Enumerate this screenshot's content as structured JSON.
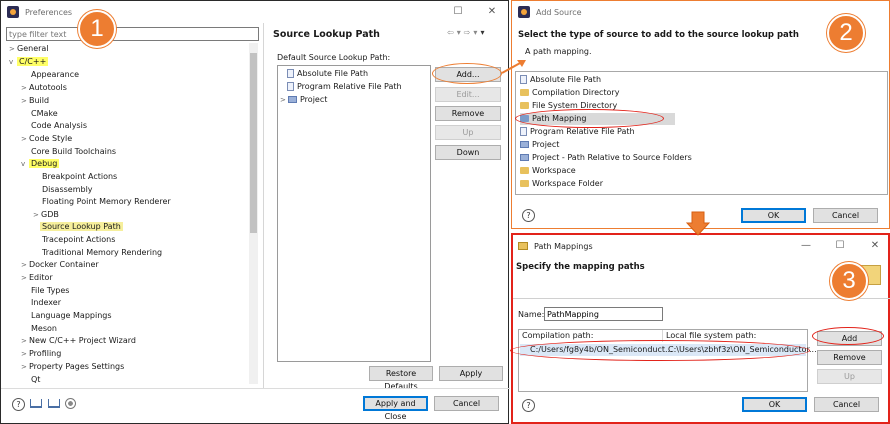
{
  "preferences": {
    "title": "Preferences",
    "filter_placeholder": "type filter text",
    "tree": {
      "general": "General",
      "cpp": "C/C++",
      "appearance": "Appearance",
      "autotools": "Autotools",
      "build": "Build",
      "cmake": "CMake",
      "code_analysis": "Code Analysis",
      "code_style": "Code Style",
      "core_build": "Core Build Toolchains",
      "debug": "Debug",
      "breakpoint_actions": "Breakpoint Actions",
      "disassembly": "Disassembly",
      "floating_point": "Floating Point Memory Renderer",
      "gdb": "GDB",
      "source_lookup_path": "Source Lookup Path",
      "tracepoint_actions": "Tracepoint Actions",
      "traditional_memory": "Traditional Memory Rendering",
      "docker": "Docker Container",
      "editor": "Editor",
      "file_types": "File Types",
      "indexer": "Indexer",
      "language_mappings": "Language Mappings",
      "meson": "Meson",
      "new_project_wizard": "New C/C++ Project Wizard",
      "profiling": "Profiling",
      "property_pages": "Property Pages Settings",
      "qt": "Qt"
    },
    "page_title": "Source Lookup Path",
    "default_label": "Default Source Lookup Path:",
    "list": {
      "absolute": "Absolute File Path",
      "program_relative": "Program Relative File Path",
      "project": "Project"
    },
    "buttons": {
      "add": "Add...",
      "edit": "Edit...",
      "remove": "Remove",
      "up": "Up",
      "down": "Down",
      "restore": "Restore Defaults",
      "apply": "Apply",
      "apply_close": "Apply and Close",
      "cancel": "Cancel"
    }
  },
  "add_source": {
    "title": "Add Source",
    "heading": "Select the type of source to add to the source lookup path",
    "subheading": "A path mapping.",
    "items": {
      "absolute": "Absolute File Path",
      "compilation_dir": "Compilation Directory",
      "fs_dir": "File System Directory",
      "path_mapping": "Path Mapping",
      "program_relative": "Program Relative File Path",
      "project": "Project",
      "project_path_relative": "Project - Path Relative to Source Folders",
      "workspace": "Workspace",
      "workspace_folder": "Workspace Folder"
    },
    "ok": "OK",
    "cancel": "Cancel"
  },
  "path_mappings": {
    "title": "Path Mappings",
    "heading": "Specify the mapping paths",
    "name_label": "Name:",
    "name_value": "PathMapping",
    "col_compilation": "Compilation path:",
    "col_local": "Local file system path:",
    "row_compilation": "C:/Users/fg8y4b/ON_Semiconduct...",
    "row_local": "C:\\Users\\zbhf3z\\ON_Semiconductor...",
    "add": "Add",
    "remove": "Remove",
    "up": "Up",
    "ok": "OK",
    "cancel": "Cancel"
  },
  "callouts": {
    "one": "1",
    "two": "2",
    "three": "3"
  },
  "colors": {
    "highlight": "#ffff66",
    "callout": "#ed7d31",
    "ring": "#e2231a",
    "frame": "#e2231a"
  }
}
